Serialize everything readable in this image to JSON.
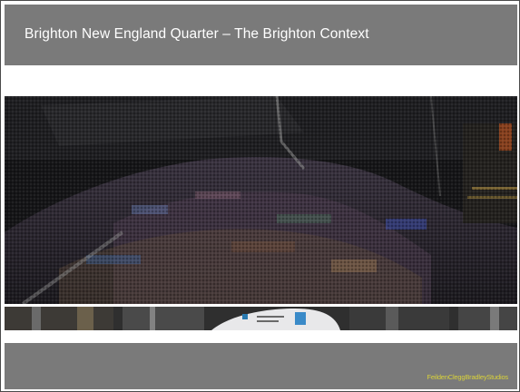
{
  "slide": {
    "title": "Brighton New England Quarter – The Brighton Context",
    "logo_text": "FeildenCleggBradleyStudios",
    "logo_color": "#d9d23a"
  },
  "colors": {
    "title_bar": "#7a7a7a",
    "footer_bar": "#7a7a7a",
    "photo_dark": "#151517"
  }
}
